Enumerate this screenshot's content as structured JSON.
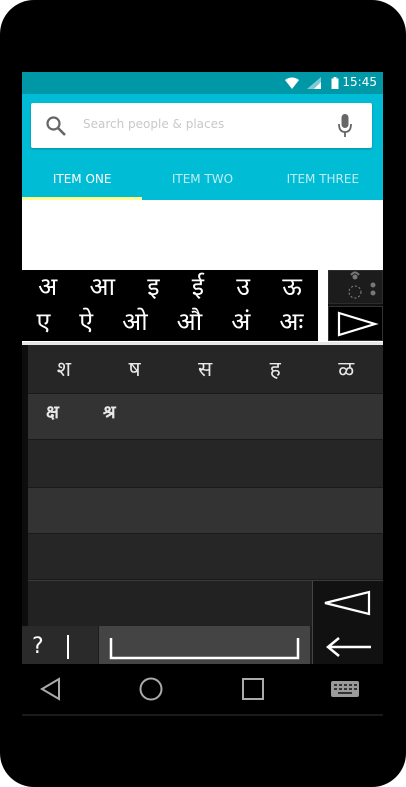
{
  "status_bar": {
    "time": "15:45"
  },
  "search": {
    "placeholder": "Search people & places"
  },
  "tabs": [
    {
      "label": "ITEM ONE",
      "active": true
    },
    {
      "label": "ITEM TWO",
      "active": false
    },
    {
      "label": "ITEM THREE",
      "active": false
    }
  ],
  "vowels": {
    "row1": [
      "अ",
      "आ",
      "इ",
      "ई",
      "उ",
      "ऊ"
    ],
    "row2": [
      "ए",
      "ऐ",
      "ओ",
      "औ",
      "अं",
      "अः"
    ]
  },
  "consonants": {
    "row1": [
      "श",
      "ष",
      "स",
      "ह",
      "ळ"
    ],
    "row2": [
      "क्ष",
      "श्र"
    ]
  },
  "keyboard": {
    "symbol_key": "?"
  },
  "colors": {
    "status_bar": "#0097a7",
    "app_bar": "#00bcd4",
    "tab_indicator": "#ffff8d"
  }
}
